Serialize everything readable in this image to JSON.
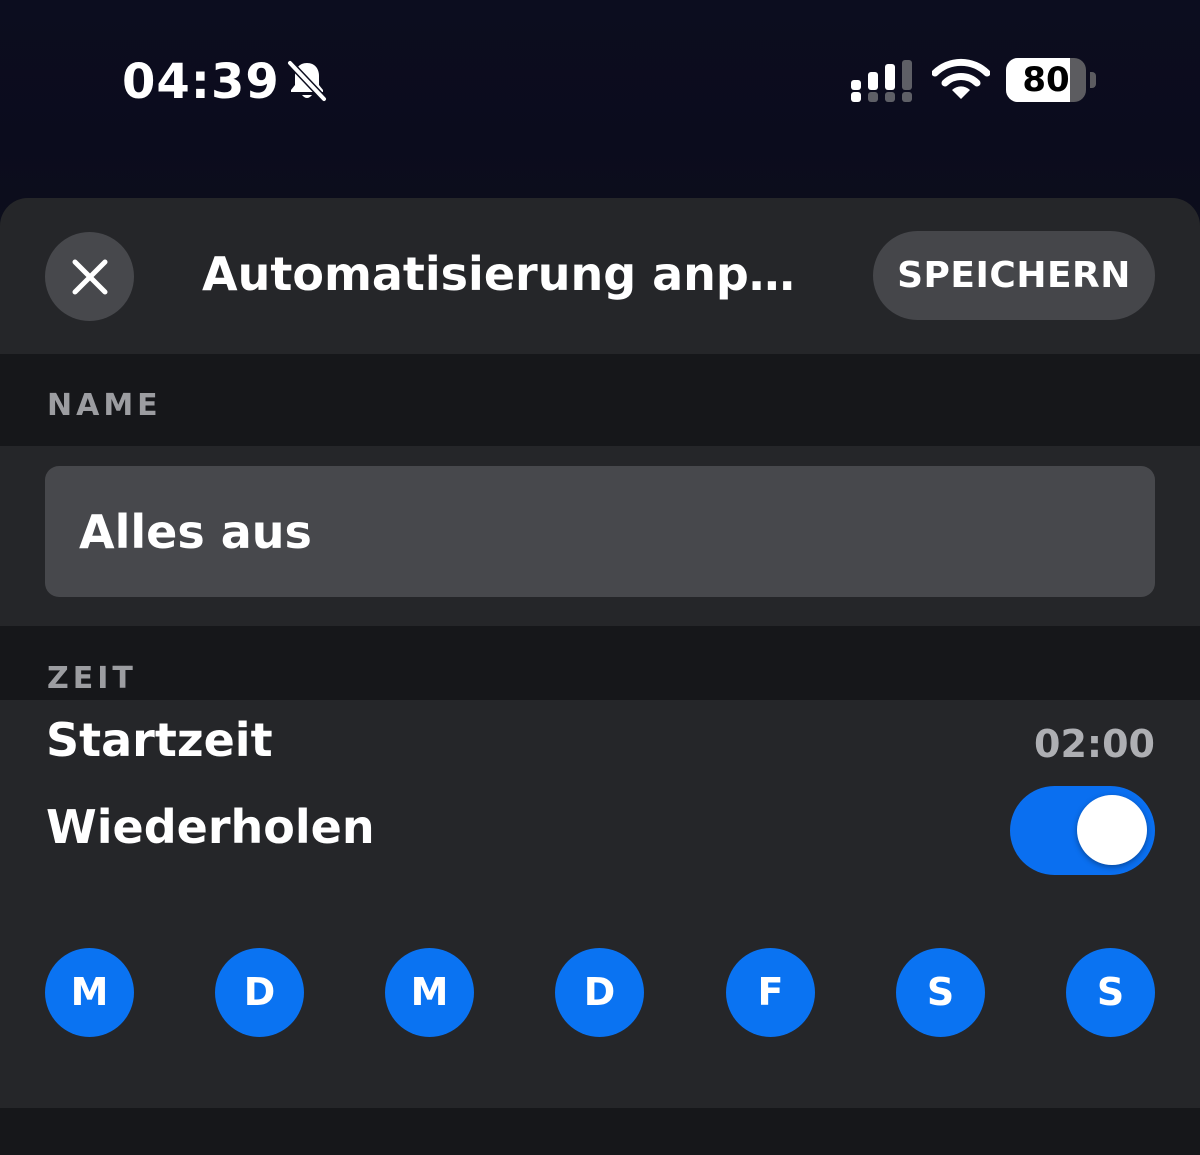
{
  "status_bar": {
    "time": "04:39",
    "battery_level": "80",
    "icons": [
      "bell-slash-icon",
      "cellular-signal-icon",
      "wifi-icon",
      "battery-icon"
    ]
  },
  "header": {
    "title": "Automatisierung anpas…",
    "save_label": "SPEICHERN",
    "close_icon": "close-icon"
  },
  "name_section": {
    "label": "NAME",
    "value": "Alles aus"
  },
  "time_section": {
    "label": "ZEIT",
    "start_label": "Startzeit",
    "start_value": "02:00",
    "repeat_label": "Wiederholen",
    "repeat_enabled": true,
    "days": [
      {
        "label": "M",
        "selected": true
      },
      {
        "label": "D",
        "selected": true
      },
      {
        "label": "M",
        "selected": true
      },
      {
        "label": "D",
        "selected": true
      },
      {
        "label": "F",
        "selected": true
      },
      {
        "label": "S",
        "selected": true
      },
      {
        "label": "S",
        "selected": true
      }
    ]
  },
  "colors": {
    "accent": "#0A73F2",
    "sheet_background": "#252629",
    "section_background": "#16171A",
    "input_background": "#47484C",
    "secondary_text": "#9C9DA1"
  }
}
